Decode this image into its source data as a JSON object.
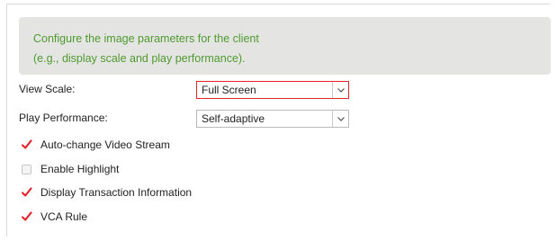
{
  "info": {
    "line1": "Configure the image parameters for the client",
    "line2": "(e.g., display scale and play performance)."
  },
  "view_scale": {
    "label": "View Scale:",
    "value": "Full Screen"
  },
  "play_performance": {
    "label": "Play Performance:",
    "value": "Self-adaptive"
  },
  "options": [
    {
      "label": "Auto-change Video Stream",
      "checked": true
    },
    {
      "label": "Enable Highlight",
      "checked": false
    },
    {
      "label": "Display Transaction Information",
      "checked": true
    },
    {
      "label": "VCA Rule",
      "checked": true
    }
  ],
  "colors": {
    "info_text": "#4f9a2f",
    "info_bg": "#e4e5e3",
    "check_mark": "#e1262b",
    "focus_border": "#e1262b"
  }
}
